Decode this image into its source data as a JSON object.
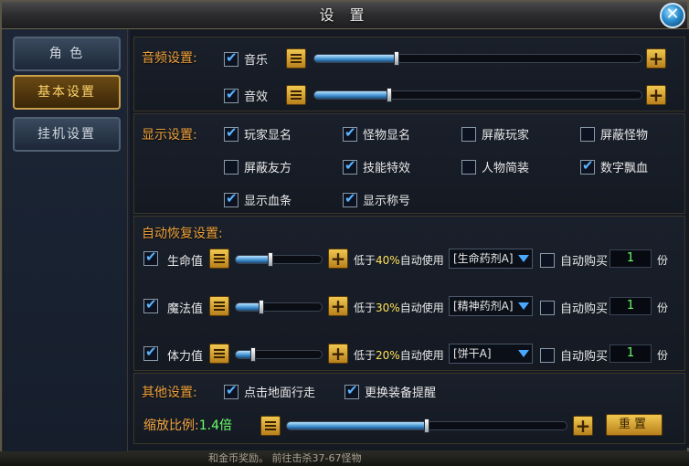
{
  "window": {
    "title": "设 置",
    "close_label": "✕"
  },
  "sidebar": {
    "tabs": [
      {
        "label": "角 色",
        "active": false
      },
      {
        "label": "基本设置",
        "active": true
      },
      {
        "label": "挂机设置",
        "active": false
      }
    ]
  },
  "audio": {
    "title": "音频设置:",
    "items": [
      {
        "label": "音乐",
        "checked": true,
        "level": 0.25
      },
      {
        "label": "音效",
        "checked": true,
        "level": 0.23
      }
    ]
  },
  "display": {
    "title": "显示设置:",
    "options": [
      {
        "label": "玩家显名",
        "checked": true
      },
      {
        "label": "怪物显名",
        "checked": true
      },
      {
        "label": "屏蔽玩家",
        "checked": false
      },
      {
        "label": "屏蔽怪物",
        "checked": false
      },
      {
        "label": "屏蔽友方",
        "checked": false
      },
      {
        "label": "技能特效",
        "checked": true
      },
      {
        "label": "人物简装",
        "checked": false
      },
      {
        "label": "数字飘血",
        "checked": true
      },
      {
        "label": "显示血条",
        "checked": true
      },
      {
        "label": "显示称号",
        "checked": true
      }
    ]
  },
  "recover": {
    "title": "自动恢复设置:",
    "rows": [
      {
        "label": "生命值",
        "checked": true,
        "level": 0.4,
        "prefix": "低于",
        "percent": "40%",
        "suffix": "自动使用",
        "item": "[生命药剂A]",
        "auto_buy_label": "自动购买",
        "auto_buy": false,
        "qty": "1",
        "unit": "份"
      },
      {
        "label": "魔法值",
        "checked": true,
        "level": 0.3,
        "prefix": "低于",
        "percent": "30%",
        "suffix": "自动使用",
        "item": "[精神药剂A]",
        "auto_buy_label": "自动购买",
        "auto_buy": false,
        "qty": "1",
        "unit": "份"
      },
      {
        "label": "体力值",
        "checked": true,
        "level": 0.2,
        "prefix": "低于",
        "percent": "20%",
        "suffix": "自动使用",
        "item": "[饼干A]",
        "auto_buy_label": "自动购买",
        "auto_buy": false,
        "qty": "1",
        "unit": "份"
      }
    ]
  },
  "other": {
    "title": "其他设置:",
    "options": [
      {
        "label": "点击地面行走",
        "checked": true
      },
      {
        "label": "更换装备提醒",
        "checked": true
      }
    ],
    "zoom_label": "缩放比例:",
    "zoom_value": "1.4倍",
    "zoom_level": 0.5,
    "reset_label": "重置"
  },
  "bottom": {
    "text": "和金币奖励。  前往击杀37-67怪物"
  }
}
